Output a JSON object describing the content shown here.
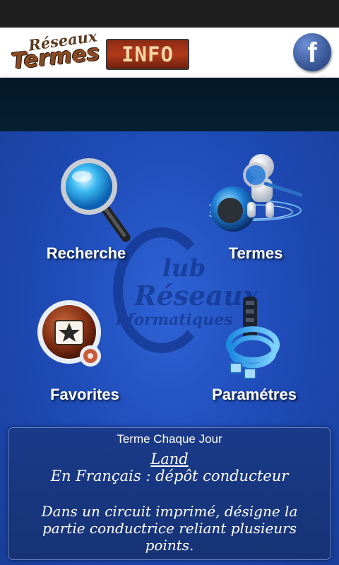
{
  "header": {
    "logo_line1": "Réseaux",
    "logo_line2": "Termes",
    "logo_info": "INFO",
    "facebook_glyph": "f"
  },
  "watermark": {
    "line1": "lub",
    "line2": "Réseaux",
    "line3": "nformatiques"
  },
  "menu": {
    "recherche": {
      "label": "Recherche",
      "icon": "magnifier-icon"
    },
    "termes": {
      "label": "Termes",
      "icon": "robot-globe-icon"
    },
    "favorites": {
      "label": "Favorites",
      "icon": "star-folder-icon"
    },
    "parametres": {
      "label": "Paramétres",
      "icon": "network-cable-icon"
    }
  },
  "daily": {
    "title": "Terme Chaque Jour",
    "term": "Land",
    "french": "En Français : dépôt conducteur",
    "definition": "Dans un circuit imprimé, désigne la partie conductrice reliant plusieurs points."
  },
  "colors": {
    "background": "#1f4cb8",
    "header_bg": "#ffffff",
    "statusbar": "#1f1f1f",
    "dark_band": "#061f33",
    "facebook": "#3b5998"
  }
}
